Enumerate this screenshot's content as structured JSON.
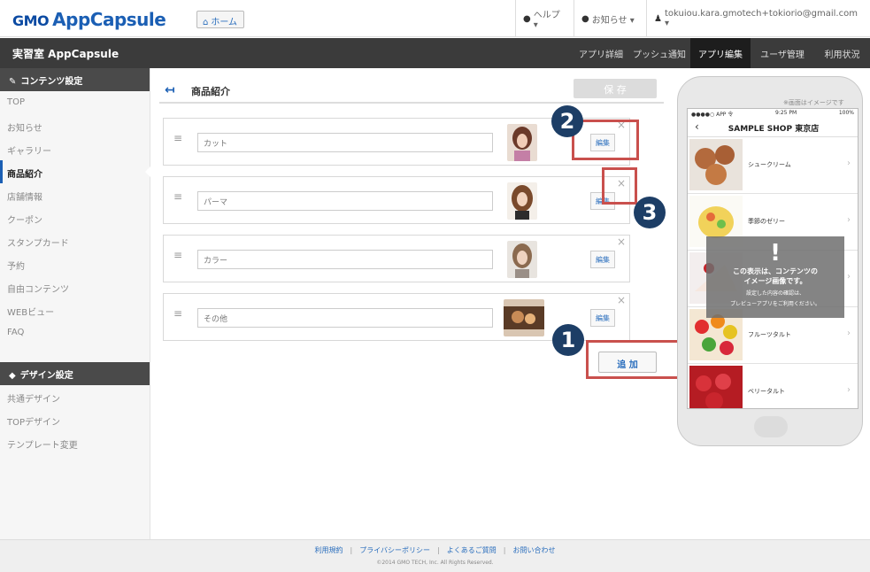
{
  "header": {
    "logo_gmo": "GMO",
    "logo_app": "AppCapsule",
    "home_label": "ホーム",
    "help_label": "ヘルプ ▾",
    "news_label": "お知らせ ▾",
    "user_label": "tokuiou.kara.gmotech+tokiorio@gmail.com ▾"
  },
  "navbar": {
    "brand": "実習室 AppCapsule",
    "tabs": [
      "アプリ詳細",
      "プッシュ通知",
      "アプリ編集",
      "ユーザ管理",
      "利用状況"
    ]
  },
  "sidebar": {
    "content_heading": "コンテンツ設定",
    "content_items": [
      "TOP",
      "お知らせ",
      "ギャラリー",
      "商品紹介",
      "店舗情報",
      "クーポン",
      "スタンプカード",
      "予約",
      "自由コンテンツ",
      "WEBビュー",
      "FAQ"
    ],
    "design_heading": "デザイン設定",
    "design_items": [
      "共通デザイン",
      "TOPデザイン",
      "テンプレート変更"
    ]
  },
  "main": {
    "title": "商品紹介",
    "save_label": "保 存",
    "add_label": "追 加",
    "edit_label": "編集",
    "items": [
      {
        "name": "カット"
      },
      {
        "name": "パーマ"
      },
      {
        "name": "カラー"
      },
      {
        "name": "その他"
      }
    ]
  },
  "callouts": [
    "1",
    "2",
    "3"
  ],
  "preview": {
    "note": "※画面はイメージです",
    "status_left": "●●●●○ APP 令",
    "status_time": "9:25 PM",
    "status_right": "100%",
    "shop_title": "SAMPLE SHOP 東京店",
    "items": [
      "シュークリーム",
      "季節のゼリー",
      "",
      "フルーツタルト",
      "ベリータルト"
    ],
    "overlay_line1": "この表示は、コンテンツの",
    "overlay_line2": "イメージ画像です。",
    "overlay_line3": "設定した内容の確認は、",
    "overlay_line4": "プレビューアプリをご利用ください。"
  },
  "footer": {
    "links": [
      "利用規約",
      "プライバシーポリシー",
      "よくあるご質問",
      "お問い合わせ"
    ],
    "copyright": "©2014 GMO TECH, Inc. All Rights Reserved."
  },
  "colors": {
    "accent": "#1b5fb4",
    "callout_box": "#c9504d",
    "callout_circle": "#1d3e66",
    "navbar": "#3b3b3b"
  }
}
